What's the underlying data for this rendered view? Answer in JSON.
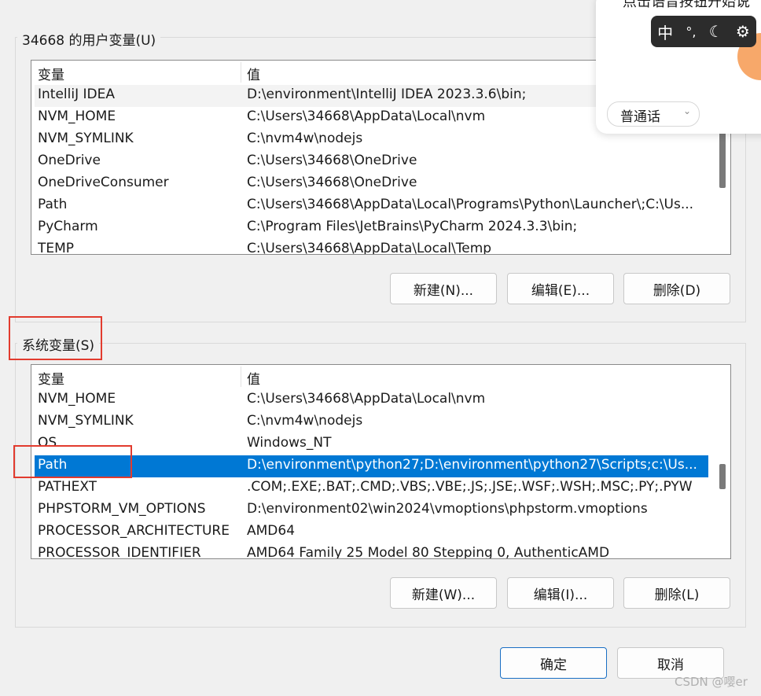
{
  "user_vars": {
    "title": "34668 的用户变量(U)",
    "col_name": "变量",
    "col_value": "值",
    "rows": [
      {
        "name": "IntelliJ IDEA",
        "value": "D:\\environment\\IntelliJ IDEA 2023.3.6\\bin;"
      },
      {
        "name": "NVM_HOME",
        "value": "C:\\Users\\34668\\AppData\\Local\\nvm"
      },
      {
        "name": "NVM_SYMLINK",
        "value": "C:\\nvm4w\\nodejs"
      },
      {
        "name": "OneDrive",
        "value": "C:\\Users\\34668\\OneDrive"
      },
      {
        "name": "OneDriveConsumer",
        "value": "C:\\Users\\34668\\OneDrive"
      },
      {
        "name": "Path",
        "value": "C:\\Users\\34668\\AppData\\Local\\Programs\\Python\\Launcher\\;C:\\Us..."
      },
      {
        "name": "PyCharm",
        "value": "C:\\Program Files\\JetBrains\\PyCharm 2024.3.3\\bin;"
      },
      {
        "name": "TEMP",
        "value": "C:\\Users\\34668\\AppData\\Local\\Temp"
      }
    ],
    "buttons": {
      "new": "新建(N)...",
      "edit": "编辑(E)...",
      "delete": "删除(D)"
    }
  },
  "system_vars": {
    "title": "系统变量(S)",
    "col_name": "变量",
    "col_value": "值",
    "rows": [
      {
        "name": "NVM_HOME",
        "value": "C:\\Users\\34668\\AppData\\Local\\nvm"
      },
      {
        "name": "NVM_SYMLINK",
        "value": "C:\\nvm4w\\nodejs"
      },
      {
        "name": "OS",
        "value": "Windows_NT"
      },
      {
        "name": "Path",
        "value": "D:\\environment\\python27;D:\\environment\\python27\\Scripts;c:\\Us...",
        "selected": true
      },
      {
        "name": "PATHEXT",
        "value": ".COM;.EXE;.BAT;.CMD;.VBS;.VBE;.JS;.JSE;.WSF;.WSH;.MSC;.PY;.PYW"
      },
      {
        "name": "PHPSTORM_VM_OPTIONS",
        "value": "D:\\environment02\\win2024\\vmoptions\\phpstorm.vmoptions"
      },
      {
        "name": "PROCESSOR_ARCHITECTURE",
        "value": "AMD64"
      },
      {
        "name": "PROCESSOR_IDENTIFIER",
        "value": "AMD64 Family 25 Model 80 Stepping 0, AuthenticAMD"
      }
    ],
    "buttons": {
      "new": "新建(W)...",
      "edit": "编辑(I)...",
      "delete": "删除(L)"
    }
  },
  "dialog": {
    "ok": "确定",
    "cancel": "取消"
  },
  "ime": {
    "prompt": "点击语音按钮开始说",
    "mode_char": "中",
    "dialect": "普通话"
  },
  "watermark": "CSDN @嘤er",
  "colors": {
    "selected": "#0078d4",
    "highlight_box": "#e23b2e"
  }
}
